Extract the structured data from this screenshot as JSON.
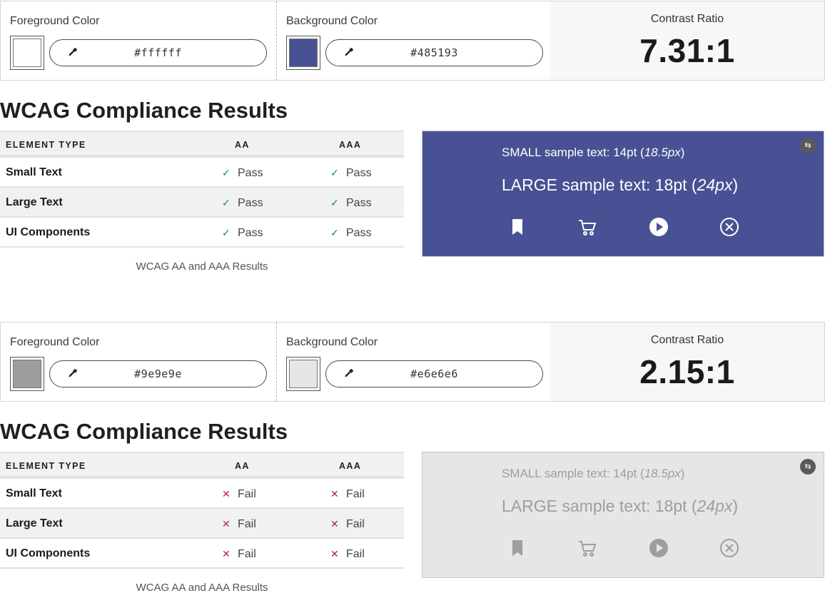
{
  "labels": {
    "foreground": "Foreground Color",
    "background": "Background Color",
    "contrast": "Contrast Ratio",
    "results_title": "WCAG Compliance Results",
    "col_type": "ELEMENT TYPE",
    "col_aa": "AA",
    "col_aaa": "AAA",
    "caption": "WCAG AA and AAA Results",
    "small_sample": "SMALL sample text: 14pt (",
    "small_sample_px": "18.5px",
    "large_sample": "LARGE sample text: 18pt (",
    "large_sample_px": "24px",
    "close_paren": ")"
  },
  "icons": [
    "eyedropper-icon",
    "bookmark-icon",
    "cart-icon",
    "play-icon",
    "close-circle-icon",
    "swap-icon"
  ],
  "examples": [
    {
      "fg": "#ffffff",
      "bg": "#485193",
      "ratio": "7.31:1",
      "rows": [
        {
          "name": "Small Text",
          "aa": "Pass",
          "aaa": "Pass"
        },
        {
          "name": "Large Text",
          "aa": "Pass",
          "aaa": "Pass"
        },
        {
          "name": "UI Components",
          "aa": "Pass",
          "aaa": "Pass"
        }
      ]
    },
    {
      "fg": "#9e9e9e",
      "bg": "#e6e6e6",
      "ratio": "2.15:1",
      "rows": [
        {
          "name": "Small Text",
          "aa": "Fail",
          "aaa": "Fail"
        },
        {
          "name": "Large Text",
          "aa": "Fail",
          "aaa": "Fail"
        },
        {
          "name": "UI Components",
          "aa": "Fail",
          "aaa": "Fail"
        }
      ]
    }
  ]
}
